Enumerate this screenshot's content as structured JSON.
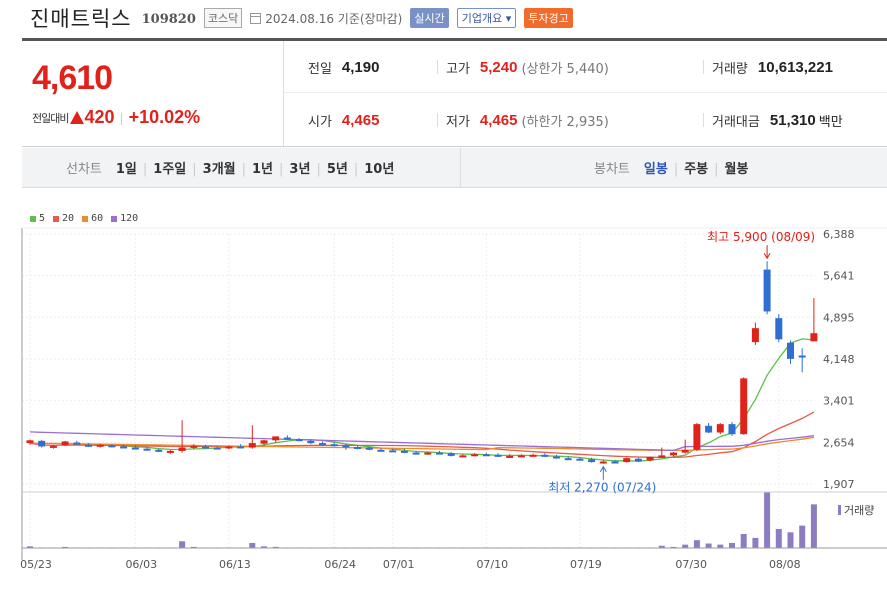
{
  "stock": {
    "name": "진매트릭스",
    "code": "109820",
    "market": "코스닥",
    "date": "2024.08.16 기준(장마감)",
    "badges": [
      "실시간",
      "기업개요 ▾",
      "투자경고"
    ]
  },
  "quote": {
    "price": "4,610",
    "change_label": "전일대비",
    "change_amount": "420",
    "change_pct": "+10.02%",
    "prev_close": {
      "label": "전일",
      "value": "4,190"
    },
    "high": {
      "label": "고가",
      "value": "5,240",
      "sub": "(상한가 5,440)"
    },
    "volume": {
      "label": "거래량",
      "value": "10,613,221"
    },
    "open": {
      "label": "시가",
      "value": "4,465"
    },
    "low": {
      "label": "저가",
      "value": "4,465",
      "sub": "(하한가 2,935)"
    },
    "trade_value": {
      "label": "거래대금",
      "value": "51,310",
      "unit": "백만"
    }
  },
  "tabs": {
    "line_label": "선차트",
    "line_tabs": [
      "1일",
      "1주일",
      "3개월",
      "1년",
      "3년",
      "5년",
      "10년"
    ],
    "candle_label": "봉차트",
    "candle_tabs": [
      "일봉",
      "주봉",
      "월봉"
    ],
    "active_candle": "일봉"
  },
  "colors": {
    "up": "#e0221b",
    "down": "#2f6fd4",
    "ma5": "#5cc04a",
    "ma20": "#e85a4a",
    "ma60": "#f08a2c",
    "ma120": "#9a6fd0",
    "volume": "#8e7cc3"
  },
  "chart_data": {
    "type": "candlestick",
    "legend": [
      "5",
      "20",
      "60",
      "120"
    ],
    "y_ticks": [
      "6,388",
      "5,641",
      "4,895",
      "4,148",
      "3,401",
      "2,654",
      "1,907"
    ],
    "ylim": [
      1907,
      6388
    ],
    "x_ticks": [
      "05/23",
      "06/03",
      "06/13",
      "06/24",
      "07/01",
      "07/10",
      "07/19",
      "07/30",
      "08/08"
    ],
    "annotation_high": "최고 5,900 (08/09)",
    "annotation_low": "최저 2,270 (07/24)",
    "volume_label": "거래량",
    "candles": [
      [
        2640,
        2700,
        2610,
        2690
      ],
      [
        2680,
        2700,
        2560,
        2580
      ],
      [
        2580,
        2610,
        2540,
        2590
      ],
      [
        2600,
        2680,
        2590,
        2670
      ],
      [
        2650,
        2680,
        2610,
        2620
      ],
      [
        2610,
        2640,
        2570,
        2590
      ],
      [
        2590,
        2630,
        2560,
        2610
      ],
      [
        2600,
        2620,
        2560,
        2570
      ],
      [
        2580,
        2610,
        2550,
        2570
      ],
      [
        2560,
        2600,
        2530,
        2540
      ],
      [
        2540,
        2570,
        2510,
        2530
      ],
      [
        2520,
        2540,
        2480,
        2500
      ],
      [
        2490,
        2520,
        2450,
        2500
      ],
      [
        2500,
        3050,
        2470,
        2560
      ],
      [
        2560,
        2620,
        2530,
        2590
      ],
      [
        2580,
        2610,
        2540,
        2560
      ],
      [
        2560,
        2590,
        2530,
        2550
      ],
      [
        2550,
        2600,
        2530,
        2580
      ],
      [
        2580,
        2620,
        2550,
        2570
      ],
      [
        2560,
        2960,
        2540,
        2640
      ],
      [
        2630,
        2700,
        2590,
        2690
      ],
      [
        2690,
        2750,
        2650,
        2760
      ],
      [
        2740,
        2780,
        2700,
        2720
      ],
      [
        2710,
        2730,
        2680,
        2700
      ],
      [
        2680,
        2700,
        2620,
        2640
      ],
      [
        2640,
        2670,
        2600,
        2620
      ],
      [
        2620,
        2650,
        2580,
        2600
      ],
      [
        2600,
        2630,
        2520,
        2570
      ],
      [
        2570,
        2600,
        2530,
        2560
      ],
      [
        2560,
        2580,
        2510,
        2520
      ],
      [
        2520,
        2550,
        2490,
        2510
      ],
      [
        2510,
        2540,
        2480,
        2490
      ],
      [
        2500,
        2540,
        2460,
        2470
      ],
      [
        2470,
        2500,
        2440,
        2460
      ],
      [
        2460,
        2490,
        2430,
        2470
      ],
      [
        2470,
        2500,
        2440,
        2460
      ],
      [
        2460,
        2480,
        2400,
        2410
      ],
      [
        2410,
        2440,
        2380,
        2420
      ],
      [
        2420,
        2460,
        2400,
        2440
      ],
      [
        2440,
        2470,
        2410,
        2430
      ],
      [
        2430,
        2460,
        2390,
        2400
      ],
      [
        2400,
        2440,
        2380,
        2410
      ],
      [
        2410,
        2440,
        2390,
        2420
      ],
      [
        2420,
        2450,
        2400,
        2430
      ],
      [
        2430,
        2460,
        2390,
        2400
      ],
      [
        2400,
        2430,
        2360,
        2370
      ],
      [
        2370,
        2400,
        2340,
        2360
      ],
      [
        2360,
        2390,
        2330,
        2350
      ],
      [
        2350,
        2380,
        2290,
        2300
      ],
      [
        2300,
        2340,
        2270,
        2310
      ],
      [
        2310,
        2340,
        2280,
        2290
      ],
      [
        2300,
        2380,
        2290,
        2370
      ],
      [
        2360,
        2380,
        2300,
        2310
      ],
      [
        2330,
        2400,
        2310,
        2390
      ],
      [
        2380,
        2560,
        2370,
        2420
      ],
      [
        2420,
        2480,
        2400,
        2470
      ],
      [
        2470,
        2700,
        2450,
        2520
      ],
      [
        2520,
        3000,
        2500,
        2980
      ],
      [
        2950,
        3000,
        2820,
        2830
      ],
      [
        2830,
        3000,
        2800,
        2980
      ],
      [
        2980,
        3020,
        2770,
        2800
      ],
      [
        2800,
        3820,
        2790,
        3800
      ],
      [
        4450,
        4800,
        4400,
        4700
      ],
      [
        5750,
        5900,
        4950,
        5000
      ],
      [
        4880,
        4950,
        4450,
        4500
      ],
      [
        4440,
        4480,
        4060,
        4150
      ],
      [
        4210,
        4340,
        3910,
        4190
      ],
      [
        4465,
        5240,
        4465,
        4610
      ]
    ],
    "volumes": [
      3,
      1,
      1,
      2,
      1,
      1,
      1,
      1,
      1,
      1,
      1,
      1,
      1,
      12,
      2,
      1,
      1,
      1,
      1,
      9,
      3,
      2,
      1,
      1,
      1,
      1,
      1,
      1,
      1,
      1,
      1,
      1,
      1,
      1,
      1,
      1,
      1,
      1,
      1,
      1,
      1,
      1,
      1,
      1,
      1,
      1,
      1,
      1,
      1,
      1,
      1,
      1,
      1,
      1,
      4,
      2,
      6,
      14,
      8,
      6,
      9,
      25,
      18,
      100,
      34,
      28,
      40,
      78
    ]
  }
}
